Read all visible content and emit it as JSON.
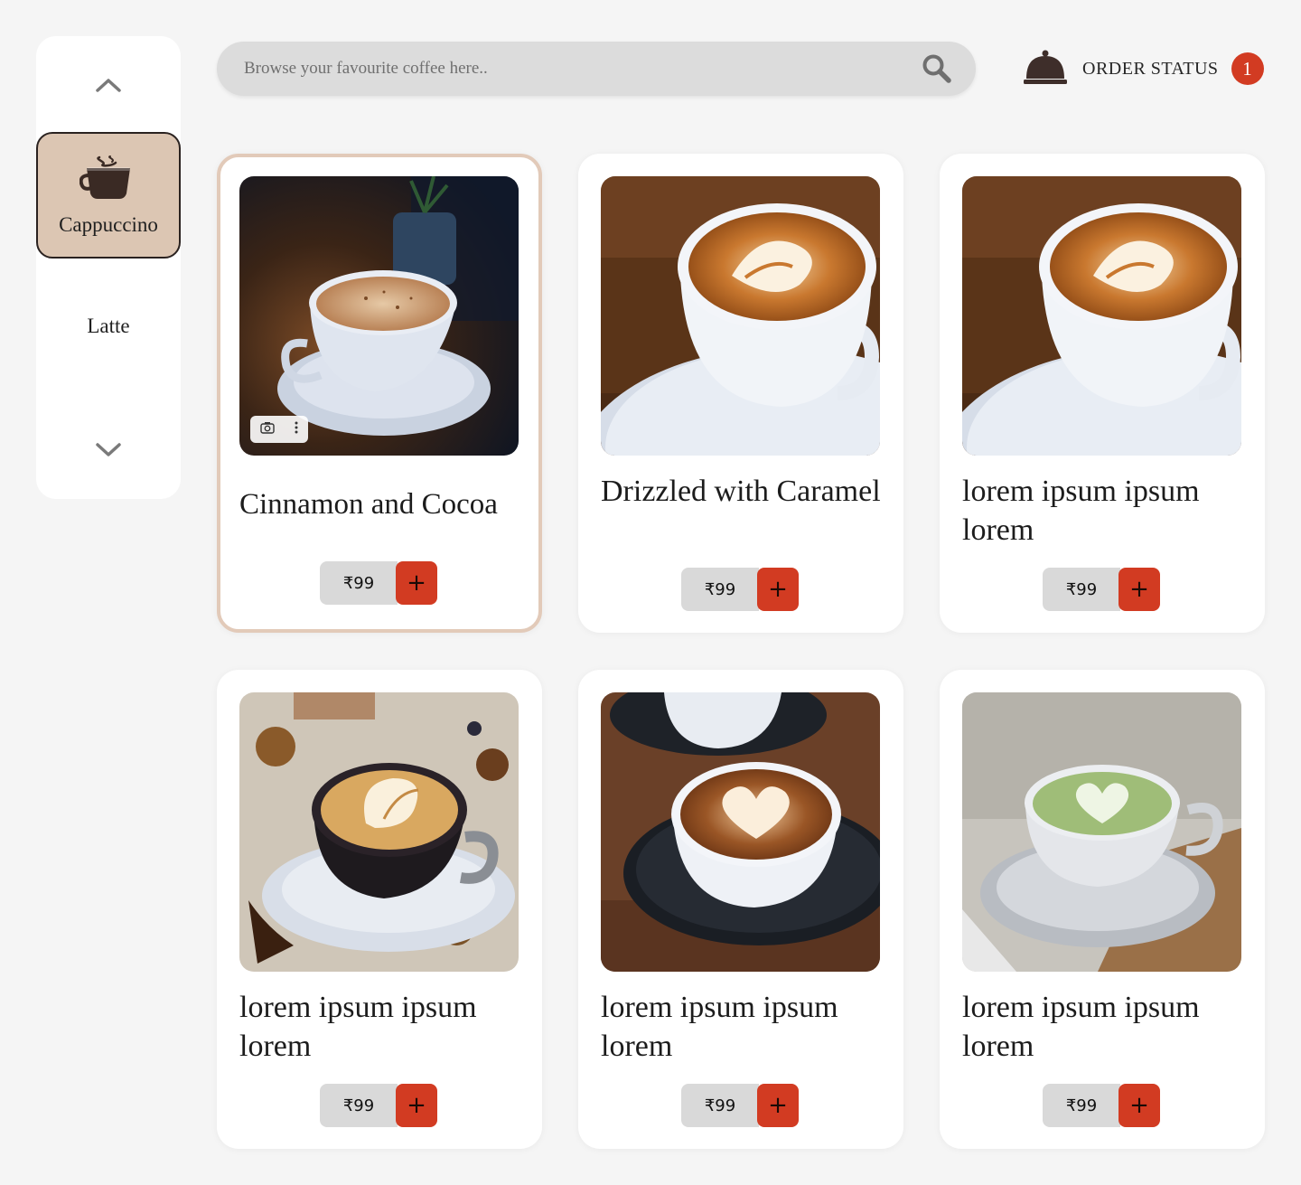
{
  "sidebar": {
    "categories": [
      {
        "label": "Cappuccino",
        "active": true
      },
      {
        "label": "Latte",
        "active": false
      }
    ]
  },
  "header": {
    "search_placeholder": "Browse your favourite coffee here..",
    "order_label": "ORDER STATUS",
    "order_count": "1"
  },
  "products": [
    {
      "name": "Cinnamon and Cocoa",
      "price": "₹99",
      "add": "+"
    },
    {
      "name": "Drizzled with Caramel",
      "price": "₹99",
      "add": "+"
    },
    {
      "name": "lorem ipsum ipsum lorem",
      "price": "₹99",
      "add": "+"
    },
    {
      "name": "lorem ipsum ipsum lorem",
      "price": "₹99",
      "add": "+"
    },
    {
      "name": "lorem ipsum ipsum lorem",
      "price": "₹99",
      "add": "+"
    },
    {
      "name": "lorem ipsum ipsum lorem",
      "price": "₹99",
      "add": "+"
    }
  ],
  "colors": {
    "accent": "#d23b22",
    "active_category": "#dcc6b3",
    "selected_border": "#e2cab9"
  }
}
